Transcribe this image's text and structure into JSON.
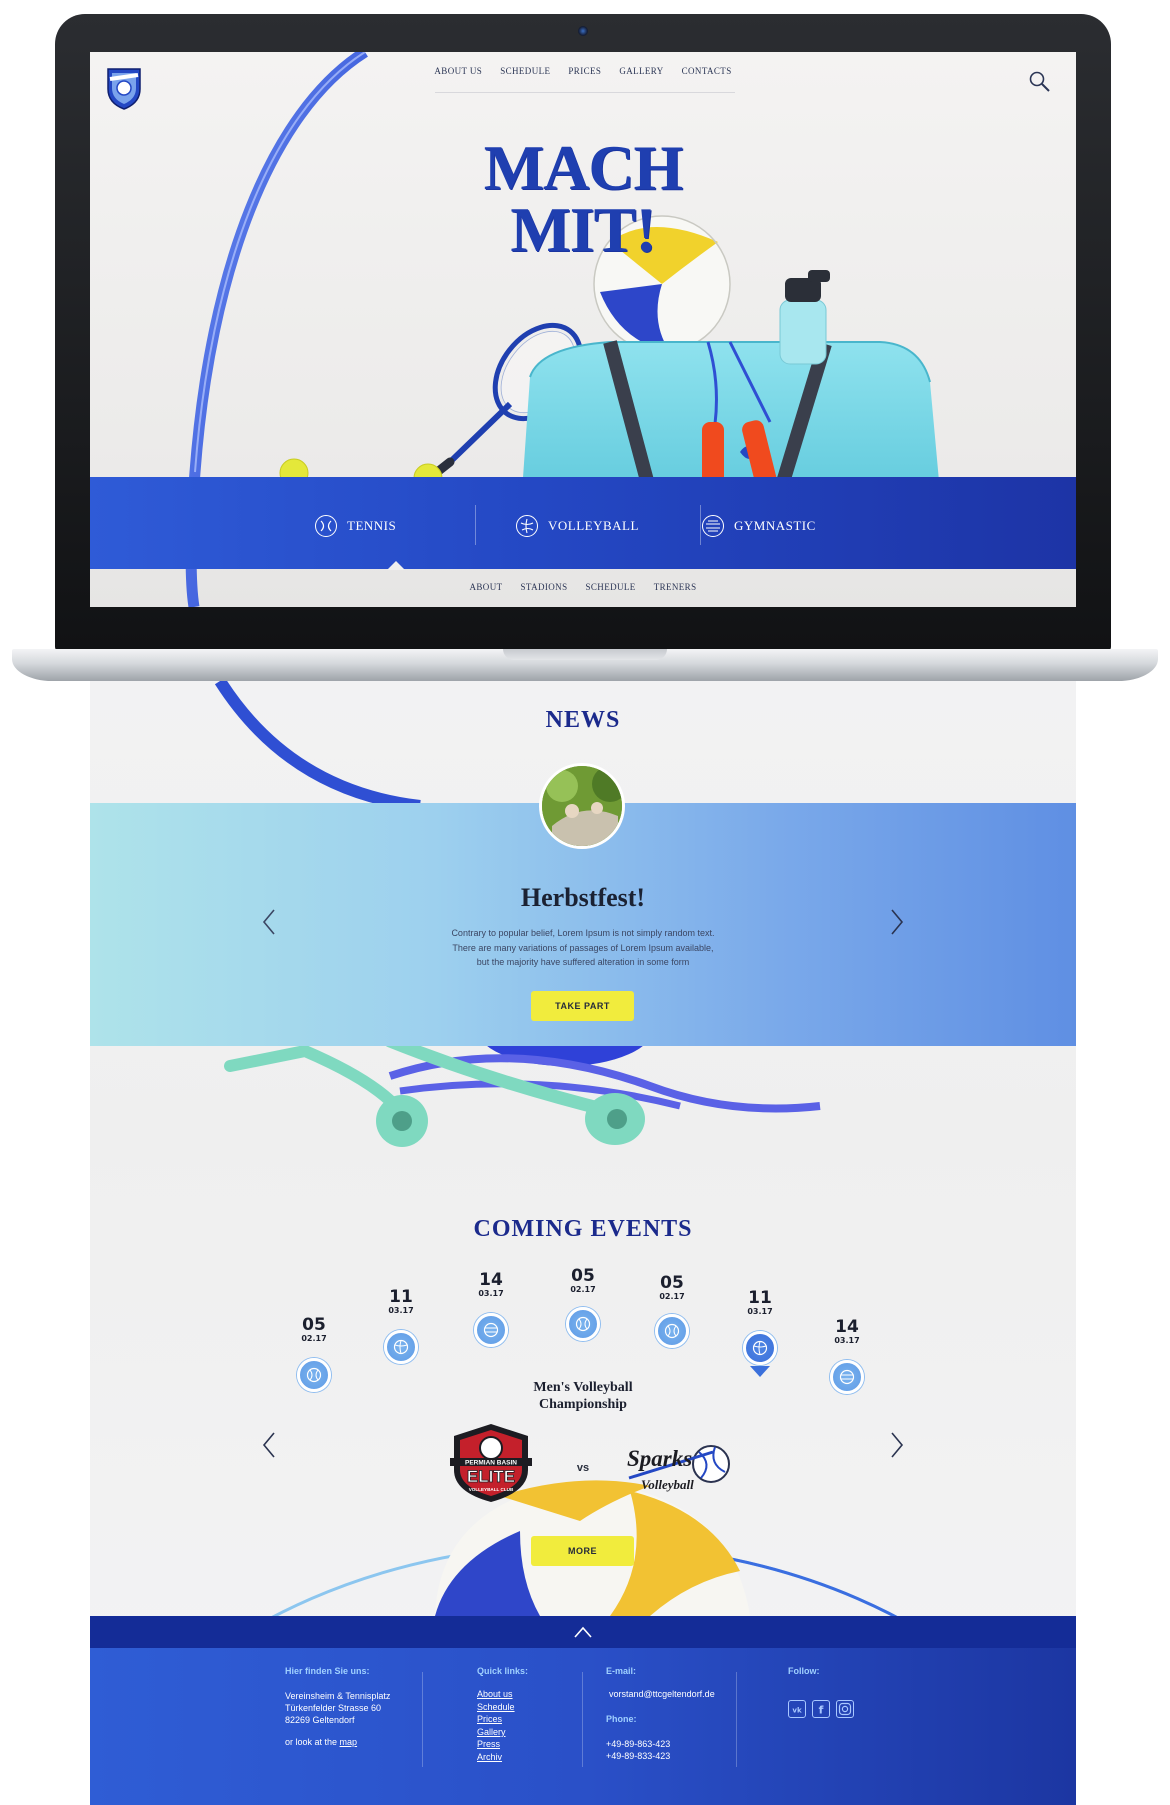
{
  "header": {
    "nav": [
      "ABOUT US",
      "SCHEDULE",
      "PRICES",
      "GALLERY",
      "CONTACTS"
    ]
  },
  "hero": {
    "title_line1": "MACH",
    "title_line2": "MIT!"
  },
  "sports": {
    "tabs": [
      {
        "label": "TENNIS",
        "icon": "tennis-ball-icon",
        "selected": true
      },
      {
        "label": "VOLLEYBALL",
        "icon": "volleyball-icon",
        "selected": false
      },
      {
        "label": "GYMNASTIC",
        "icon": "gymnastic-ball-icon",
        "selected": false
      }
    ],
    "subnav": [
      "ABOUT",
      "STADIONS",
      "SCHEDULE",
      "TRENERS"
    ]
  },
  "news": {
    "title": "NEWS",
    "headline": "Herbstfest!",
    "body": [
      "Contrary to popular belief, Lorem Ipsum is not simply random text.",
      "There are many variations of passages of Lorem Ipsum available,",
      "but the majority have suffered alteration in some form"
    ],
    "button": "TAKE PART"
  },
  "events": {
    "title": "COMING EVENTS",
    "timeline": [
      {
        "day": "05",
        "month": "02.17",
        "icon": "tennis-ball-icon"
      },
      {
        "day": "11",
        "month": "03.17",
        "icon": "volleyball-icon"
      },
      {
        "day": "14",
        "month": "03.17",
        "icon": "gymnastic-ball-icon"
      },
      {
        "day": "05",
        "month": "02.17",
        "icon": "tennis-ball-icon"
      },
      {
        "day": "05",
        "month": "02.17",
        "icon": "tennis-ball-icon"
      },
      {
        "day": "11",
        "month": "03.17",
        "icon": "volleyball-icon",
        "selected": true
      },
      {
        "day": "14",
        "month": "03.17",
        "icon": "gymnastic-ball-icon"
      }
    ],
    "event_name_line1": "Men's Volleyball",
    "event_name_line2": "Championship",
    "team_left": {
      "line1": "PERMIAN BASIN",
      "line2": "ELITE",
      "line3": "VOLLEYBALL CLUB"
    },
    "vs": "vs",
    "team_right": {
      "line1": "Sparks",
      "line2": "Volleyball"
    },
    "button": "MORE"
  },
  "footer": {
    "address_head": "Hier finden Sie uns:",
    "address": [
      "Vereinsheim & Tennisplatz",
      "Türkenfelder Strasse 60",
      "82269 Geltendorf"
    ],
    "map_prefix": "or look at the ",
    "map_link": "map",
    "links_head": "Quick links:",
    "links": [
      "About us",
      "Schedule",
      "Prices",
      "Gallery",
      "Press",
      "Archiv"
    ],
    "email_head": "E-mail:",
    "email": "vorstand@ttcgeltendorf.de",
    "phone_head": "Phone:",
    "phones": [
      "+49-89-863-423",
      "+49-89-833-423"
    ],
    "follow_head": "Follow:",
    "social": [
      "vk-icon",
      "facebook-icon",
      "instagram-icon"
    ]
  },
  "colors": {
    "brand_blue": "#2448c4",
    "navy": "#1b2a8c",
    "button_yellow": "#f1ec3d",
    "news_gradient_start": "#aee3ea",
    "news_gradient_end": "#5f8fe3"
  }
}
